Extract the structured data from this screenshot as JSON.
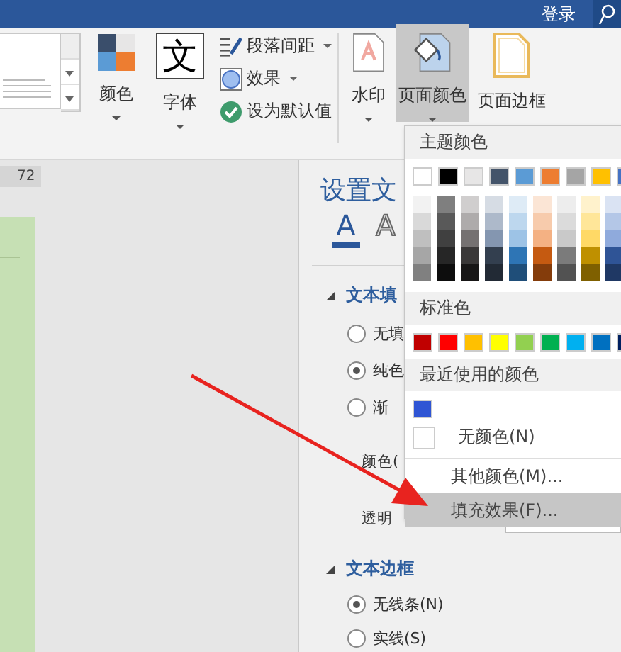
{
  "title_bar": {
    "login": "登录"
  },
  "ribbon": {
    "buttons": [
      {
        "kind": "colors",
        "label": "颜色",
        "selected": false
      },
      {
        "kind": "fonts",
        "label": "字体",
        "glyph": "文",
        "selected": false
      }
    ],
    "options": [
      {
        "kind": "spacing",
        "label": "段落间距",
        "dropdown": true
      },
      {
        "kind": "effects",
        "label": "效果",
        "dropdown": true
      },
      {
        "kind": "default",
        "label": "设为默认值",
        "dropdown": false
      }
    ],
    "page_buttons": [
      {
        "kind": "watermark",
        "label": "水印",
        "selected": false
      },
      {
        "kind": "page_color",
        "label": "页面颜色",
        "selected": true
      },
      {
        "kind": "page_border",
        "label": "页面边框",
        "selected": false
      }
    ]
  },
  "ruler": {
    "reading": "72"
  },
  "format_pane": {
    "title": "设置文",
    "tabs": [
      {
        "label": "A",
        "selected": true
      },
      {
        "label": "A",
        "selected": false
      }
    ],
    "fill_section": {
      "title": "文本填",
      "expanded": true,
      "options": [
        {
          "label": "无填",
          "selected": false
        },
        {
          "label": "纯色",
          "selected": true
        },
        {
          "label": "渐",
          "selected": false
        }
      ]
    },
    "color_label": "颜色(",
    "transparency_label": "透明",
    "border_section": {
      "title": "文本边框",
      "expanded": true,
      "options": [
        {
          "label": "无线条(N)",
          "selected": true
        },
        {
          "label": "实线(S)",
          "selected": false
        }
      ]
    }
  },
  "color_menu": {
    "theme_header": "主题颜色",
    "theme_colors": [
      {
        "color": "#ffffff",
        "shades": [
          {
            "color": "#f2f2f2"
          },
          {
            "color": "#d9d9d9"
          },
          {
            "color": "#bfbfbf"
          },
          {
            "color": "#a6a6a6"
          },
          {
            "color": "#808080"
          }
        ]
      },
      {
        "color": "#000000",
        "shades": [
          {
            "color": "#7f7f7f"
          },
          {
            "color": "#595959"
          },
          {
            "color": "#404040"
          },
          {
            "color": "#262626"
          },
          {
            "color": "#0d0d0d"
          }
        ]
      },
      {
        "color": "#e7e6e6",
        "shades": [
          {
            "color": "#d0cece"
          },
          {
            "color": "#aeabab"
          },
          {
            "color": "#757171"
          },
          {
            "color": "#3a3838"
          },
          {
            "color": "#171616"
          }
        ]
      },
      {
        "color": "#44546a",
        "shades": [
          {
            "color": "#d6dce4"
          },
          {
            "color": "#adb9ca"
          },
          {
            "color": "#8496b0"
          },
          {
            "color": "#333f4f"
          },
          {
            "color": "#222a35"
          }
        ]
      },
      {
        "color": "#5b9bd5",
        "shades": [
          {
            "color": "#deebf6"
          },
          {
            "color": "#bdd7ee"
          },
          {
            "color": "#9dc3e6"
          },
          {
            "color": "#2e75b5"
          },
          {
            "color": "#1f4e79"
          }
        ]
      },
      {
        "color": "#ed7d31",
        "shades": [
          {
            "color": "#fbe5d5"
          },
          {
            "color": "#f7cbac"
          },
          {
            "color": "#f4b183"
          },
          {
            "color": "#c55a11"
          },
          {
            "color": "#843c0b"
          }
        ]
      },
      {
        "color": "#a5a5a5",
        "shades": [
          {
            "color": "#ededed"
          },
          {
            "color": "#dbdbdb"
          },
          {
            "color": "#c9c9c9"
          },
          {
            "color": "#7b7b7b"
          },
          {
            "color": "#525252"
          }
        ]
      },
      {
        "color": "#ffc000",
        "shades": [
          {
            "color": "#fff2cc"
          },
          {
            "color": "#ffe699"
          },
          {
            "color": "#ffd966"
          },
          {
            "color": "#bf9000"
          },
          {
            "color": "#7f6000"
          }
        ]
      },
      {
        "color": "#4472c4",
        "shades": [
          {
            "color": "#dae3f3"
          },
          {
            "color": "#b4c7e7"
          },
          {
            "color": "#8faadc"
          },
          {
            "color": "#2f5496"
          },
          {
            "color": "#1f3864"
          }
        ]
      }
    ],
    "standard_header": "标准色",
    "standard_colors": [
      {
        "color": "#c00000"
      },
      {
        "color": "#ff0000"
      },
      {
        "color": "#ffc000"
      },
      {
        "color": "#ffff00"
      },
      {
        "color": "#92d050"
      },
      {
        "color": "#00b050"
      },
      {
        "color": "#00b0f0"
      },
      {
        "color": "#0070c0"
      },
      {
        "color": "#002060"
      }
    ],
    "recent_header": "最近使用的颜色",
    "recent_colors": [
      {
        "color": "#2f55d4"
      }
    ],
    "no_color": "无颜色(N)",
    "items": [
      {
        "label": "其他颜色(M)...",
        "selected": false
      },
      {
        "label": "填充效果(F)...",
        "selected": true
      }
    ]
  }
}
